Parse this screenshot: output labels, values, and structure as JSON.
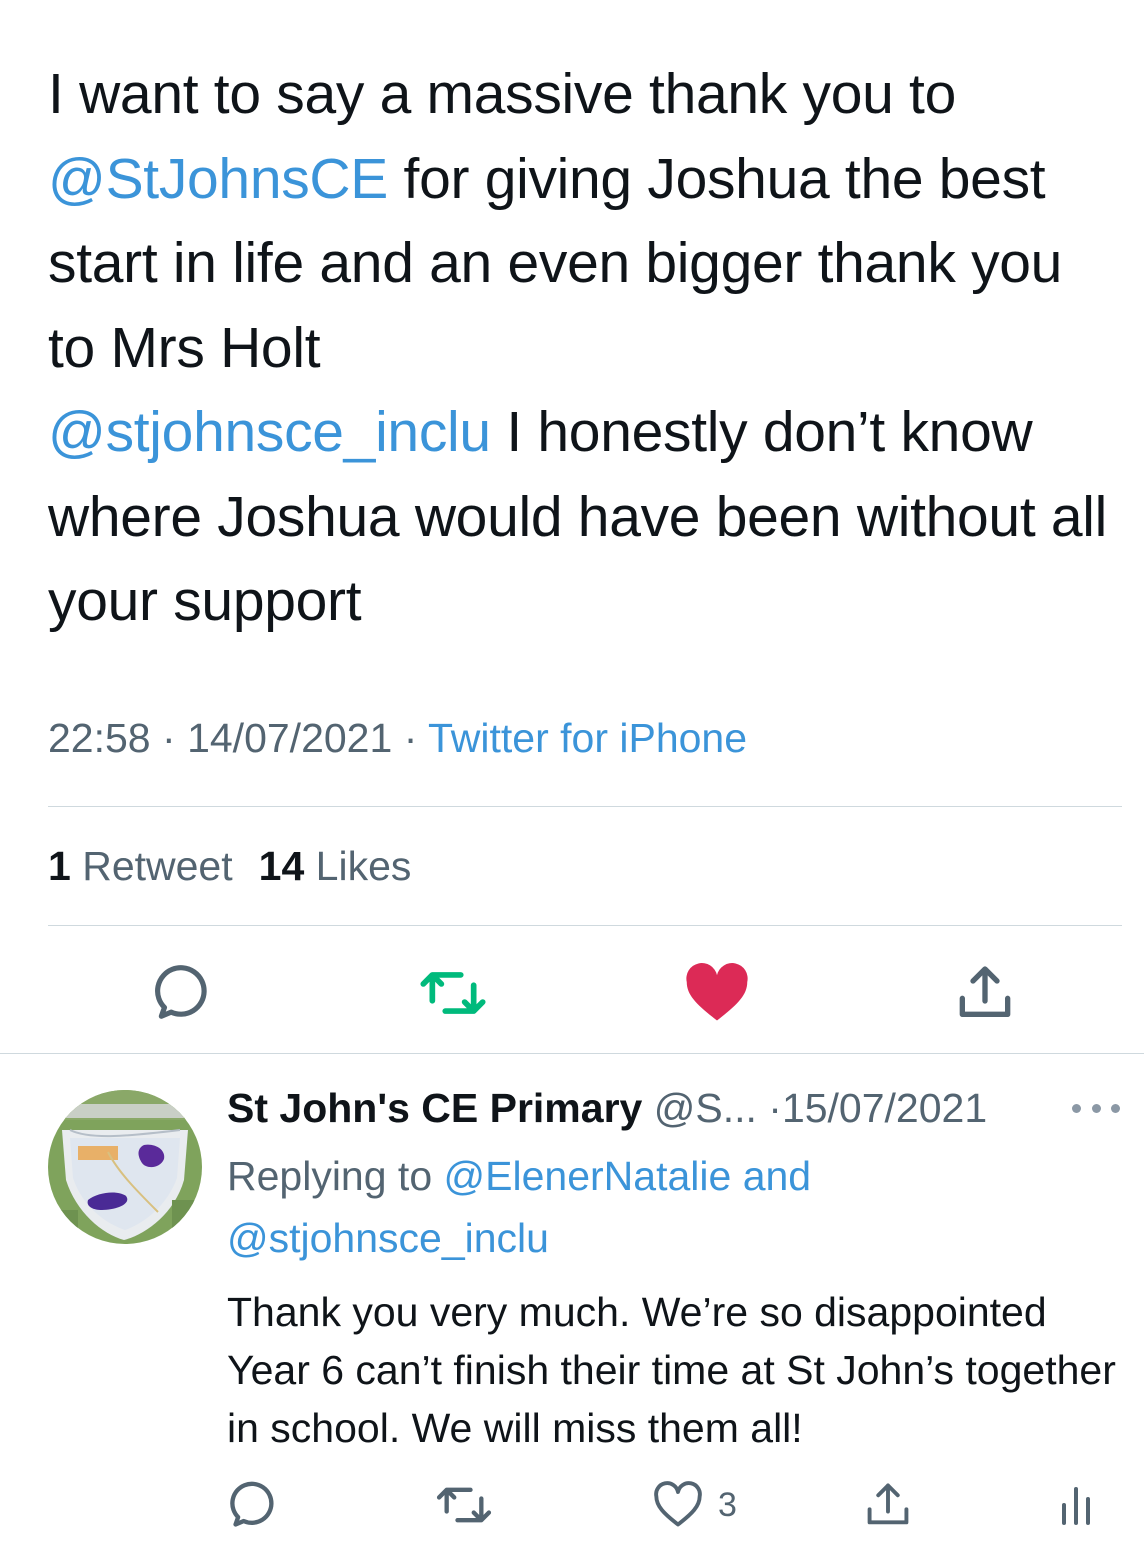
{
  "main_tweet": {
    "text_segments": [
      {
        "type": "plain",
        "text": "I want to say a massive thank you to "
      },
      {
        "type": "mention",
        "text": "@StJohnsCE"
      },
      {
        "type": "plain",
        "text": " for giving Joshua the best start in life and an even bigger thank you to Mrs Holt "
      },
      {
        "type": "mention",
        "text": "@stjohnsce_inclu"
      },
      {
        "type": "plain",
        "text": "  I honestly don’t know where Joshua would have been without all your support"
      }
    ],
    "time": "22:58",
    "separator": "·",
    "date": "14/07/2021",
    "source": "Twitter for iPhone",
    "retweets_count": "1",
    "retweets_label": "Retweet",
    "likes_count": "14",
    "likes_label": "Likes",
    "liked": true
  },
  "actions": {
    "reply_icon": "reply-icon",
    "retweet_icon": "retweet-icon",
    "like_icon": "heart-filled-icon",
    "share_icon": "share-icon"
  },
  "reply": {
    "display_name": "St John's CE Primary",
    "handle": "@S...",
    "separator": "·",
    "date": "15/07/2021",
    "replying_prefix": "Replying to",
    "replying_to_1": "@ElenerNatalie",
    "replying_and": "and",
    "replying_to_2": "@stjohnsce_inclu",
    "text": "Thank you very much. We’re so disappointed Year 6 can’t finish their time at St John’s together in school. We will miss them all!",
    "like_count": "3",
    "more_icon": "more-options-icon"
  },
  "colors": {
    "link": "#3b94d9",
    "text": "#0f1419",
    "secondary": "#536471",
    "retweet_green": "#00ba7c",
    "like_red": "#dc2a56",
    "divider": "#cfd9de"
  }
}
